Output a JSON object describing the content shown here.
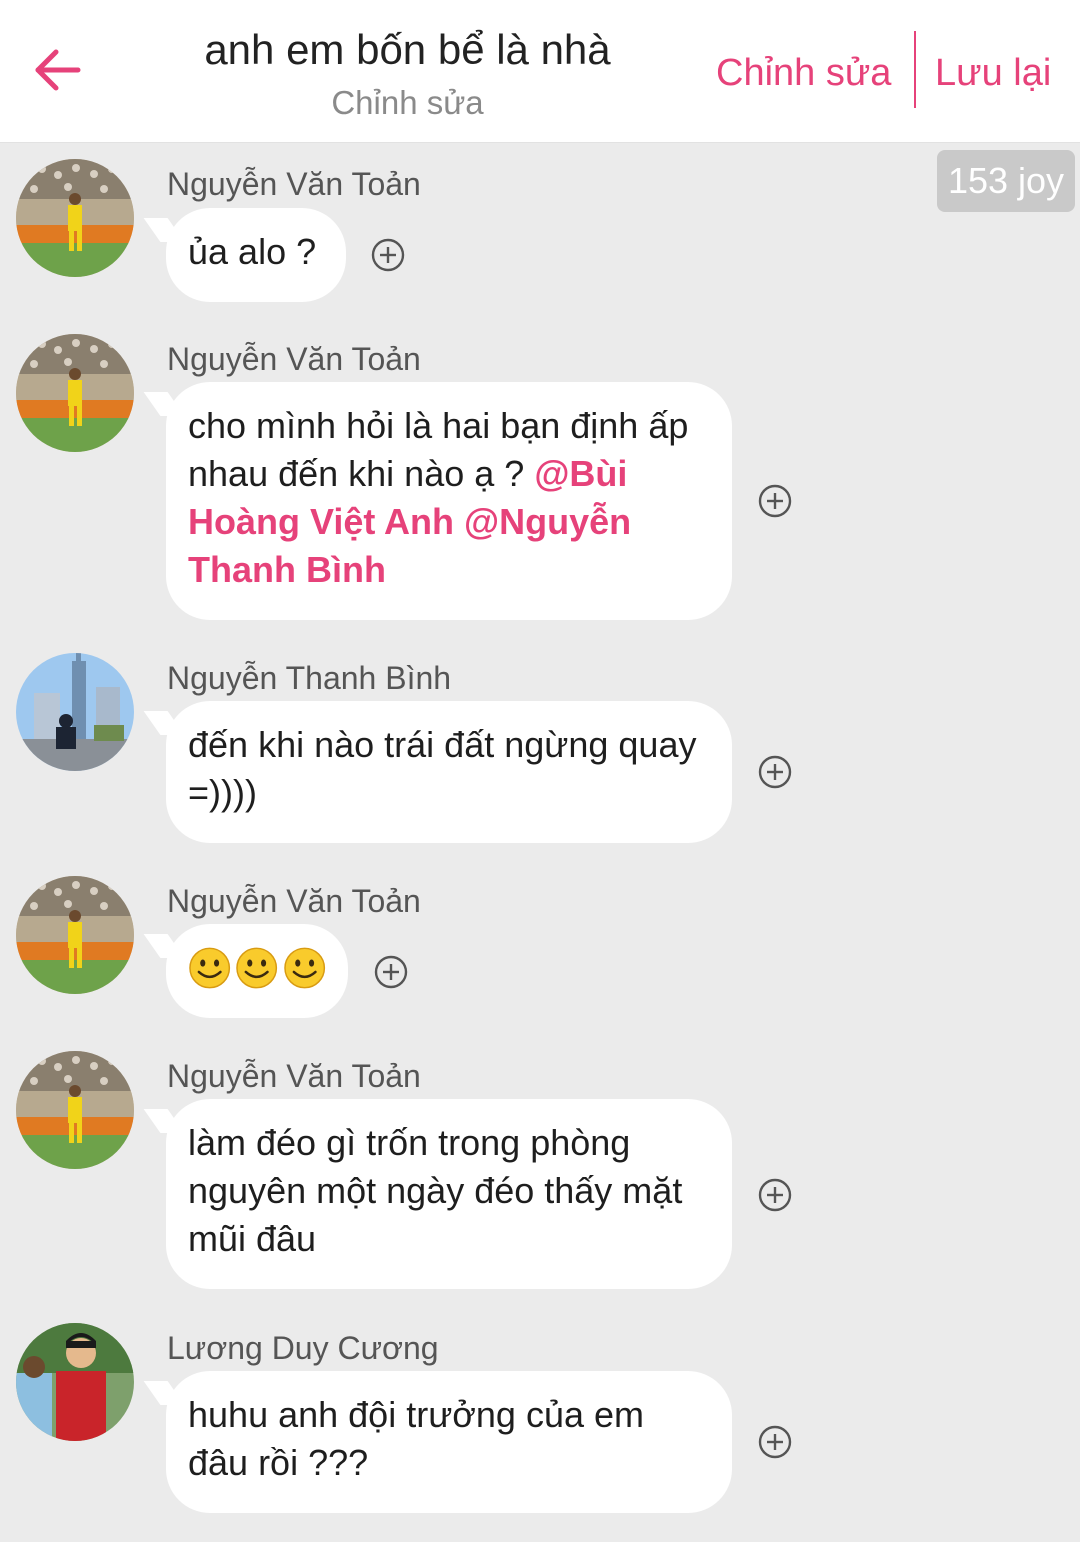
{
  "header": {
    "title": "anh em bốn bể là nhà",
    "subtitle": "Chỉnh sửa",
    "edit_label": "Chỉnh sửa",
    "save_label": "Lưu lại",
    "accent_color": "#e6427a"
  },
  "joy_badge": "153 joy",
  "messages": [
    {
      "sender": "Nguyễn Văn Toản",
      "text": "ủa alo ?"
    },
    {
      "sender": "Nguyễn Văn Toản",
      "text": "cho mình hỏi là hai bạn định ấp nhau đến khi nào ạ ?",
      "mentions": [
        "@Bùi Hoàng Việt Anh",
        "@Nguyễn Thanh Bình"
      ]
    },
    {
      "sender": "Nguyễn Thanh Bình",
      "text": "đến khi nào trái đất ngừng quay =))))"
    },
    {
      "sender": "Nguyễn Văn Toản",
      "emoji": [
        "smiley-icon",
        "smiley-icon",
        "smiley-icon"
      ]
    },
    {
      "sender": "Nguyễn Văn Toản",
      "text": "làm đéo gì trốn trong phòng nguyên một ngày đéo thấy mặt mũi đâu"
    },
    {
      "sender": "Lương Duy Cương",
      "text": "huhu anh đội trưởng của em đâu rồi ???"
    }
  ]
}
